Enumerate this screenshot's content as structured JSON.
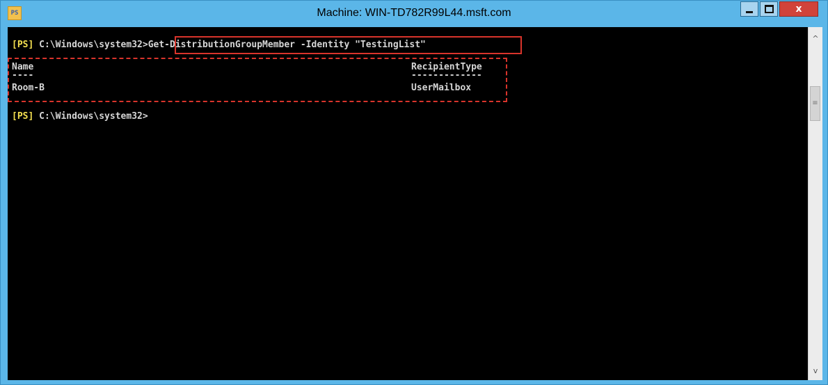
{
  "window": {
    "title": "Machine: WIN-TD782R99L44.msft.com",
    "icon": "powershell-icon",
    "icon_glyph": "PS",
    "buttons": {
      "minimize": "minimize-icon",
      "maximize": "maximize-icon",
      "close": "close-icon",
      "close_glyph": "x"
    },
    "accent_color": "#5bb6e8",
    "close_color": "#d1433a"
  },
  "console": {
    "background": "#000000",
    "lines": [
      {
        "prompt_tag": "[PS]",
        "prompt_path": " C:\\Windows\\system32>",
        "command": "Get-DistributionGroupMember -Identity \"TestingList\""
      },
      {
        "col1": "Name",
        "col2": "RecipientType"
      },
      {
        "col1": "----",
        "col2": "-------------"
      },
      {
        "col1": "Room-B",
        "col2": "UserMailbox"
      },
      {
        "prompt_tag": "[PS]",
        "prompt_path": " C:\\Windows\\system32>"
      }
    ],
    "highlight_color": "#d9342b"
  },
  "scrollbar": {
    "up_glyph": "^",
    "down_glyph": "v",
    "thumb_glyph": "≡"
  }
}
